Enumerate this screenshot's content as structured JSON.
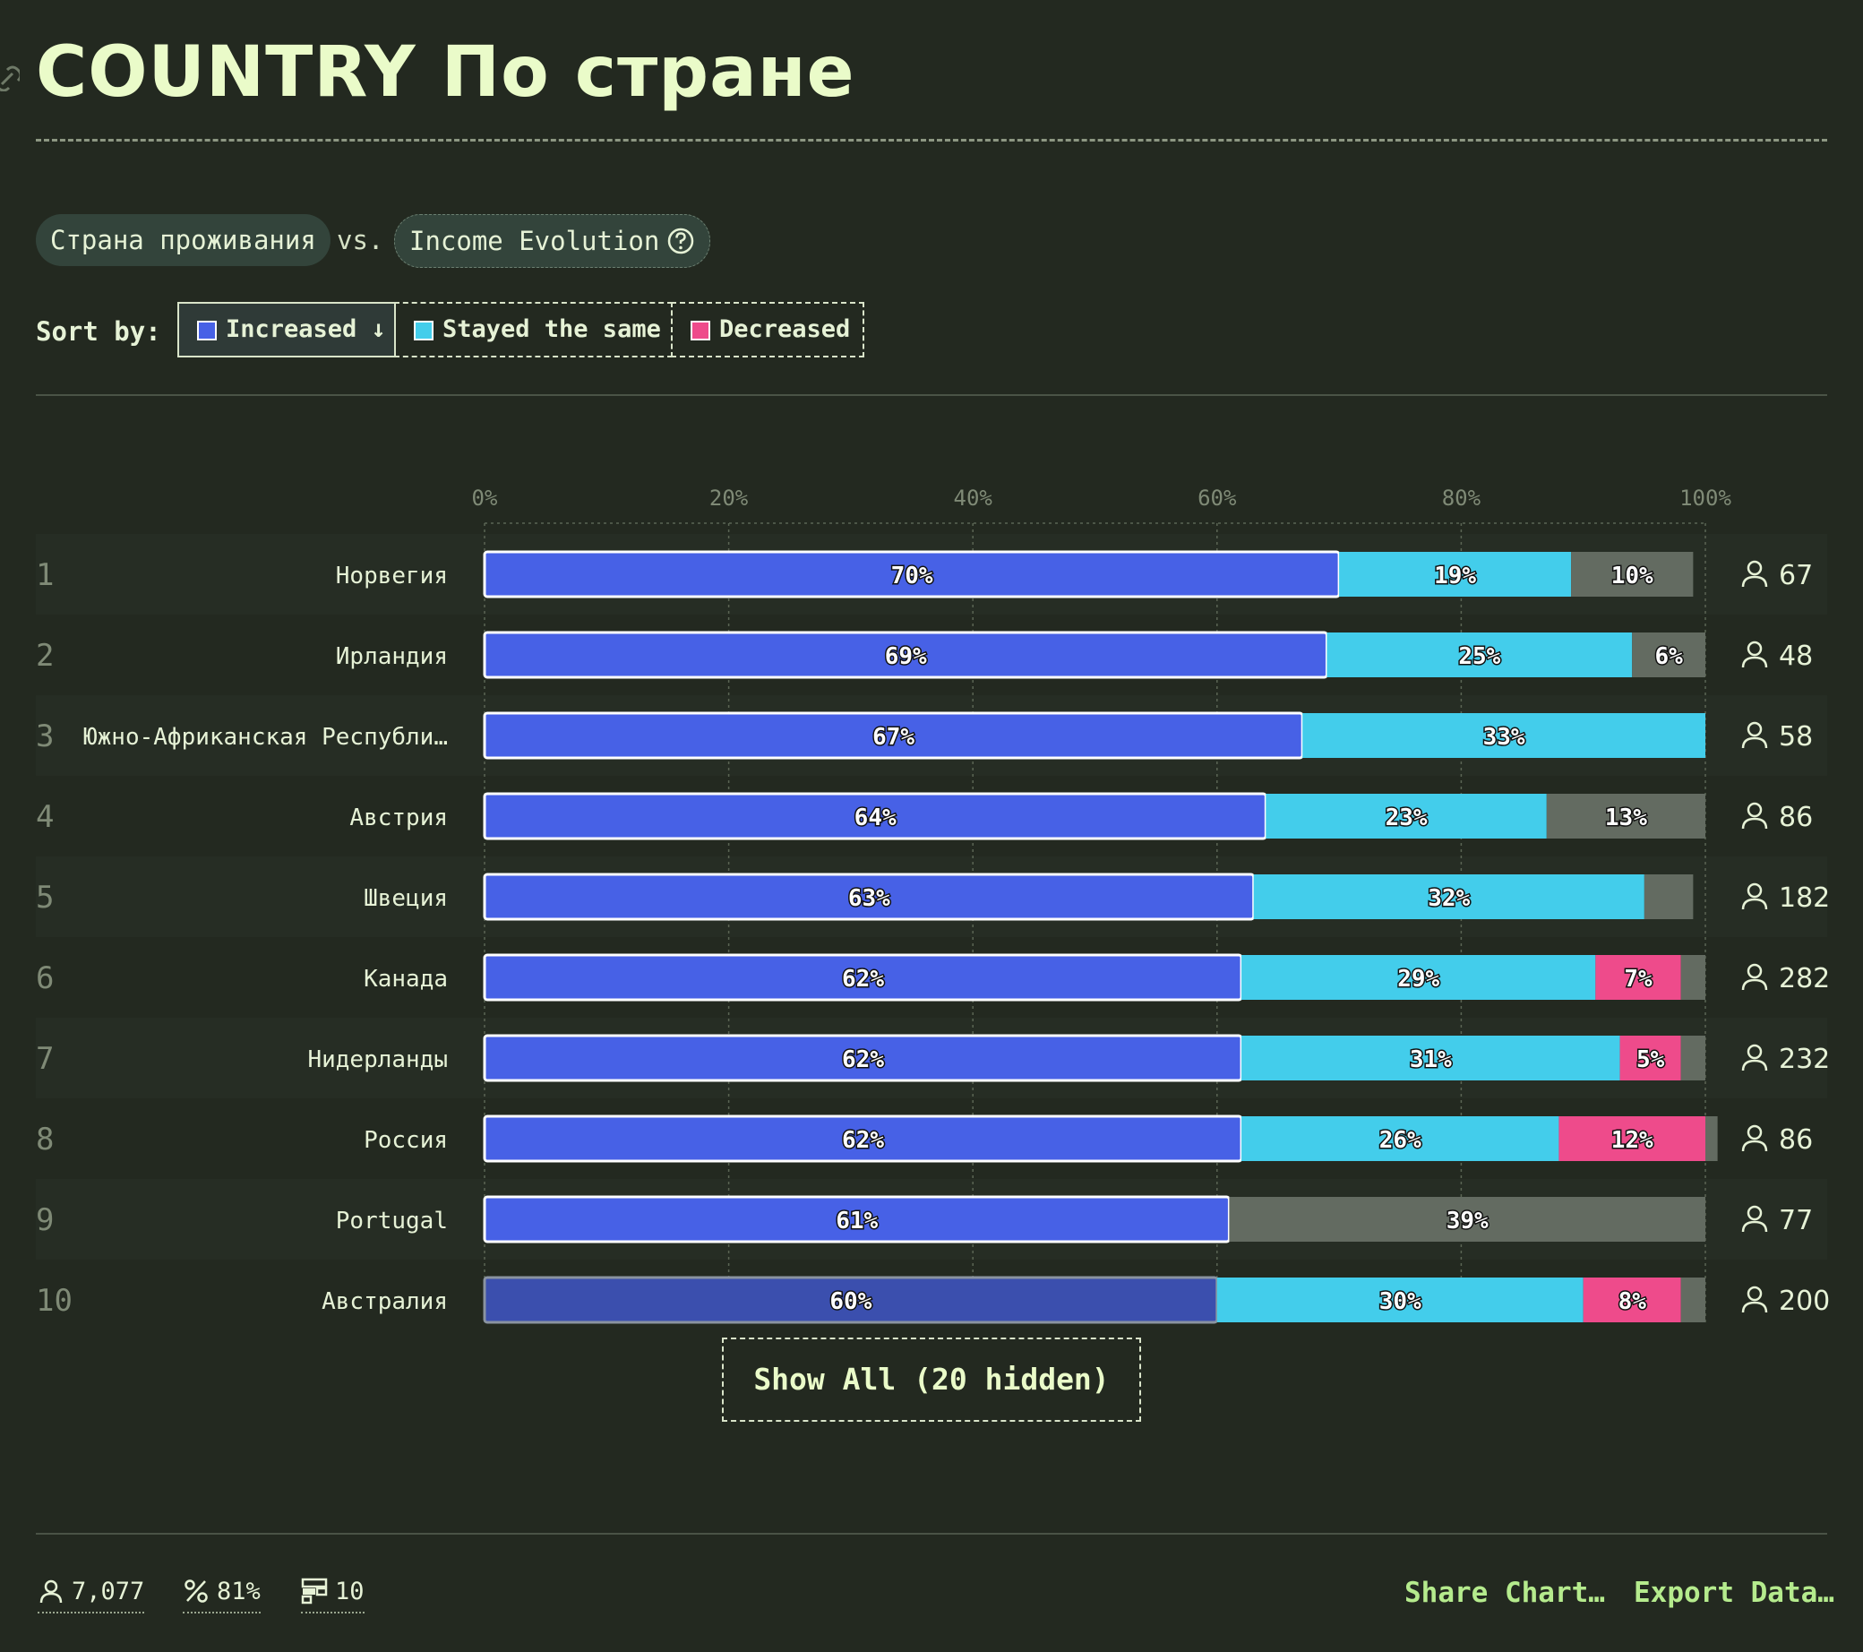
{
  "header": {
    "title": "COUNTRY По стране"
  },
  "selectors": {
    "left": "Страна проживания",
    "vs": "vs.",
    "right": "Income Evolution"
  },
  "sort": {
    "label": "Sort by:",
    "options": [
      {
        "label": "Increased ↓",
        "color": "#4761e6",
        "active": true
      },
      {
        "label": "Stayed the same",
        "color": "#43cdeb",
        "active": false
      },
      {
        "label": "Decreased",
        "color": "#ee4b8b",
        "active": false
      }
    ]
  },
  "chart_data": {
    "type": "bar",
    "stacked": true,
    "orientation": "horizontal",
    "xlim": [
      0,
      100
    ],
    "ticks": [
      "0%",
      "20%",
      "40%",
      "60%",
      "80%",
      "100%"
    ],
    "series_colors": {
      "increased": "#4761e6",
      "same": "#43cdeb",
      "decreased": "#ee4b8b",
      "other": "#636b61"
    },
    "rows": [
      {
        "rank": "1",
        "country": "Норвегия",
        "increased": 70,
        "same": 19,
        "decreased": 0,
        "other": 10,
        "count": "67"
      },
      {
        "rank": "2",
        "country": "Ирландия",
        "increased": 69,
        "same": 25,
        "decreased": 0,
        "other": 6,
        "count": "48"
      },
      {
        "rank": "3",
        "country": "Южно-Африканская Республи…",
        "increased": 67,
        "same": 33,
        "decreased": 0,
        "other": 0,
        "count": "58"
      },
      {
        "rank": "4",
        "country": "Австрия",
        "increased": 64,
        "same": 23,
        "decreased": 0,
        "other": 13,
        "count": "86"
      },
      {
        "rank": "5",
        "country": "Швеция",
        "increased": 63,
        "same": 32,
        "decreased": 0,
        "other": 4,
        "count": "182"
      },
      {
        "rank": "6",
        "country": "Канада",
        "increased": 62,
        "same": 29,
        "decreased": 7,
        "other": 2,
        "count": "282"
      },
      {
        "rank": "7",
        "country": "Нидерланды",
        "increased": 62,
        "same": 31,
        "decreased": 5,
        "other": 2,
        "count": "232"
      },
      {
        "rank": "8",
        "country": "Россия",
        "increased": 62,
        "same": 26,
        "decreased": 12,
        "other": 1,
        "count": "86"
      },
      {
        "rank": "9",
        "country": "Portugal",
        "increased": 61,
        "same": 0,
        "decreased": 0,
        "other": 39,
        "count": "77"
      },
      {
        "rank": "10",
        "country": "Австралия",
        "increased": 60,
        "same": 30,
        "decreased": 8,
        "other": 2,
        "count": "200"
      }
    ]
  },
  "show_all": {
    "label": "Show All (20 hidden)"
  },
  "footer": {
    "respondents": "7,077",
    "percent": "81%",
    "groups": "10",
    "share": "Share Chart…",
    "export": "Export Data…"
  }
}
